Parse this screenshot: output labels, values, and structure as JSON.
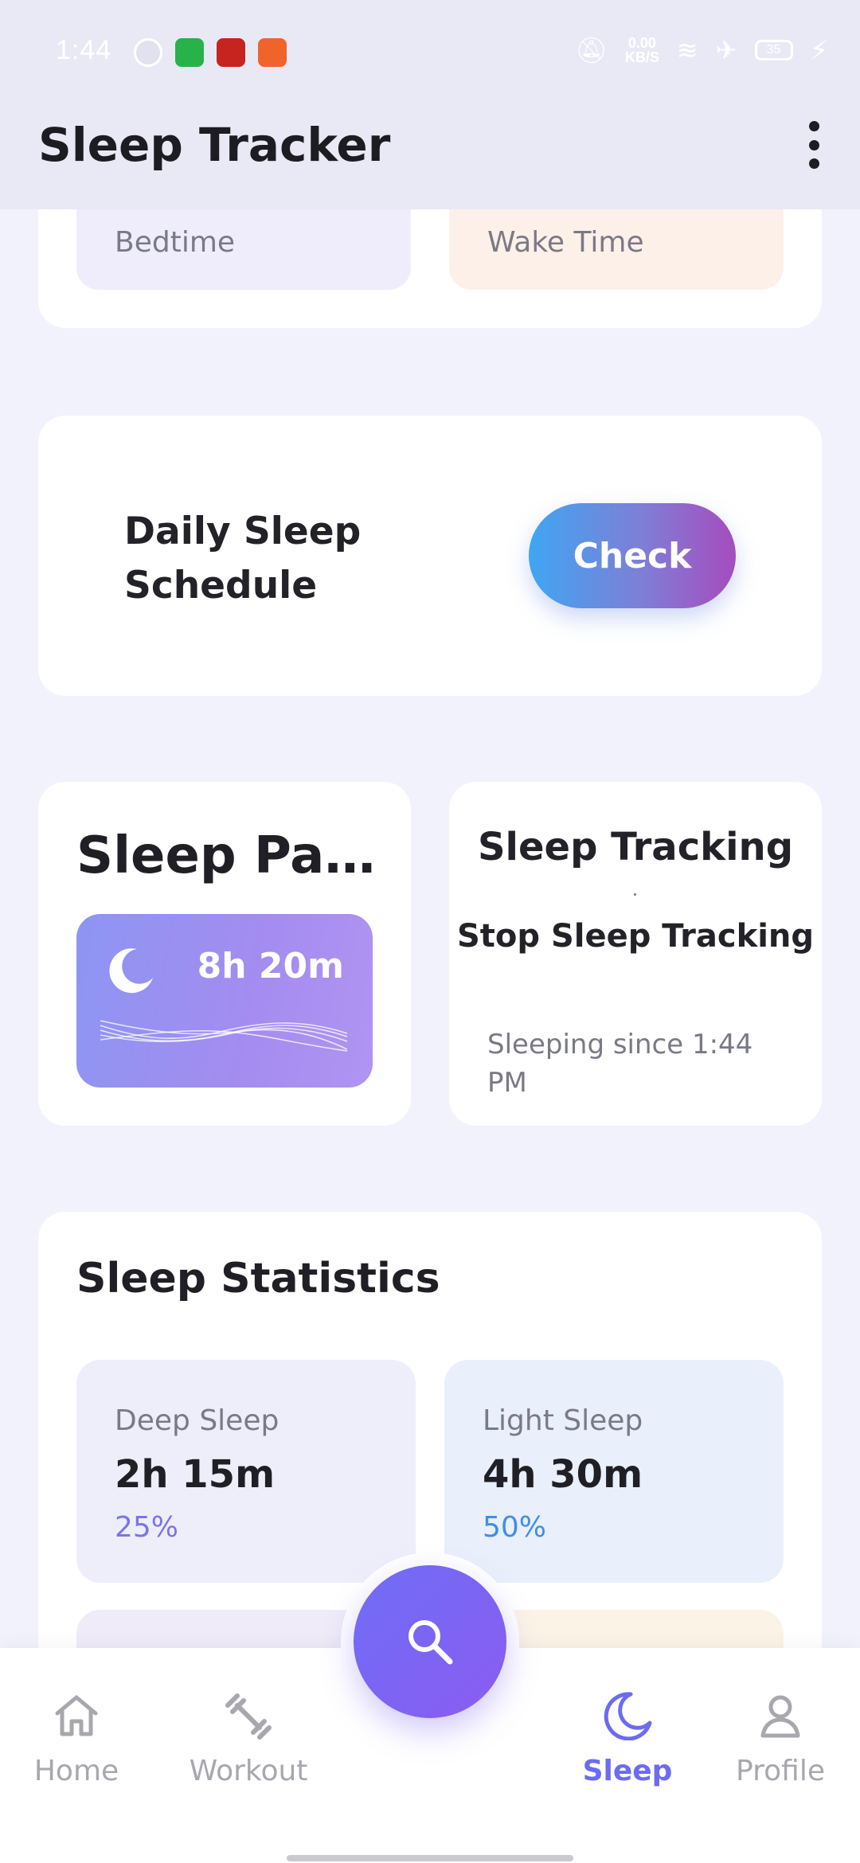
{
  "status_bar": {
    "time": "1:44",
    "net_speed": "0.00",
    "net_unit": "KB/S",
    "battery": "35"
  },
  "app_bar": {
    "title": "Sleep Tracker"
  },
  "time_card": {
    "bedtime_label": "Bedtime",
    "waketime_label": "Wake Time"
  },
  "schedule": {
    "title": "Daily Sleep Schedule",
    "check_label": "Check"
  },
  "pattern": {
    "title": "Sleep Pat...",
    "duration": "8h 20m"
  },
  "tracking": {
    "title": "Sleep Tracking",
    "stop_label": "Stop Sleep Tracking",
    "since": "Sleeping since 1:44 PM"
  },
  "stats": {
    "title": "Sleep Statistics",
    "deep": {
      "label": "Deep Sleep",
      "value": "2h 15m",
      "percent": "25%"
    },
    "light": {
      "label": "Light Sleep",
      "value": "4h 30m",
      "percent": "50%"
    }
  },
  "nav": {
    "home": "Home",
    "workout": "Workout",
    "sleep": "Sleep",
    "profile": "Profile"
  },
  "colors": {
    "accent": "#6b6cf0",
    "deep_pct": "#7b74ea",
    "light_pct": "#3e8fe8"
  }
}
